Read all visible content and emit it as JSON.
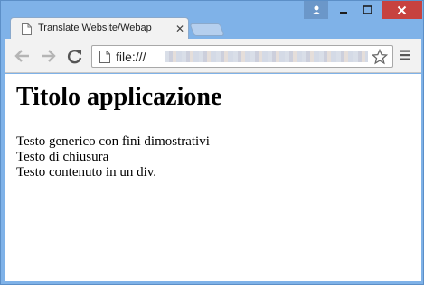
{
  "browser": {
    "tab": {
      "title": "Translate Website/Webap",
      "favicon": "page-icon",
      "close_icon": "close-icon"
    },
    "window_controls": [
      "user-icon",
      "minimize-icon",
      "maximize-icon",
      "close-icon"
    ],
    "toolbar": {
      "back_icon": "arrow-left-icon",
      "forward_icon": "arrow-right-icon",
      "reload_icon": "reload-icon",
      "address": "file:///",
      "star_icon": "star-icon",
      "menu_icon": "hamburger-menu-icon"
    },
    "colors": {
      "frame": "#7fb2e8",
      "close_button": "#c7423f",
      "toolbar": "#f2f2f2"
    }
  },
  "page": {
    "title": "Titolo applicazione",
    "lines": [
      "Testo generico con fini dimostrativi",
      "Testo di chiusura",
      "Testo contenuto in un div."
    ]
  }
}
